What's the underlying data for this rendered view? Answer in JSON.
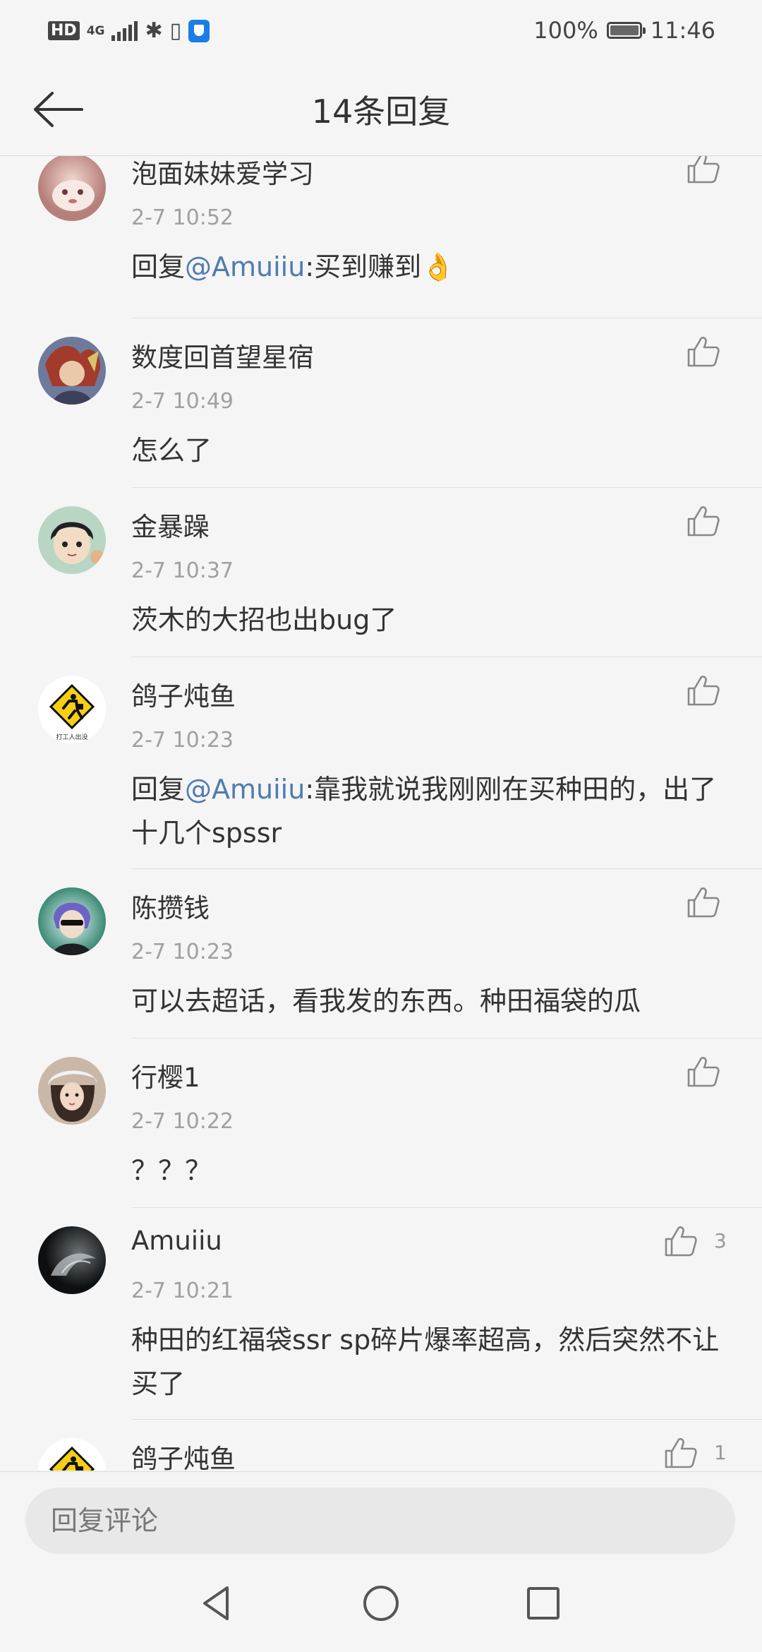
{
  "status_bar": {
    "hd": "HD",
    "network": "4G",
    "battery": "100%",
    "time": "11:46"
  },
  "header": {
    "title": "14条回复"
  },
  "comments": [
    {
      "username": "泡面妹妹爱学习",
      "time": "2-7 10:52",
      "prefix": "回复",
      "mention": "@Amuiiu",
      "text": ":买到赚到👌",
      "likes": ""
    },
    {
      "username": "数度回首望星宿",
      "time": "2-7 10:49",
      "prefix": "",
      "mention": "",
      "text": "怎么了",
      "likes": ""
    },
    {
      "username": "金暴躁",
      "time": "2-7 10:37",
      "prefix": "",
      "mention": "",
      "text": "茨木的大招也出bug了",
      "likes": ""
    },
    {
      "username": "鸽子炖鱼",
      "time": "2-7 10:23",
      "prefix": "回复",
      "mention": "@Amuiiu",
      "text": ":靠我就说我刚刚在买种田的，出了十几个spssr",
      "likes": ""
    },
    {
      "username": "陈攒钱",
      "time": "2-7 10:23",
      "prefix": "",
      "mention": "",
      "text": "可以去超话，看我发的东西。种田福袋的瓜",
      "likes": ""
    },
    {
      "username": "行樱1",
      "time": "2-7 10:22",
      "prefix": "",
      "mention": "",
      "text": "？？？",
      "likes": ""
    },
    {
      "username": "Amuiiu",
      "time": "2-7 10:21",
      "prefix": "",
      "mention": "",
      "text": "种田的红福袋ssr sp碎片爆率超高，然后突然不让买了",
      "likes": "3"
    },
    {
      "username": "鸽子炖鱼",
      "time": "",
      "prefix": "",
      "mention": "",
      "text": "",
      "likes": "1"
    }
  ],
  "avatar_sign": "打工人出没",
  "reply_box": {
    "placeholder": "回复评论"
  },
  "colors": {
    "mention": "#4f7bb0",
    "background": "#f5f5f5",
    "input_bg": "#e8e8e8"
  }
}
